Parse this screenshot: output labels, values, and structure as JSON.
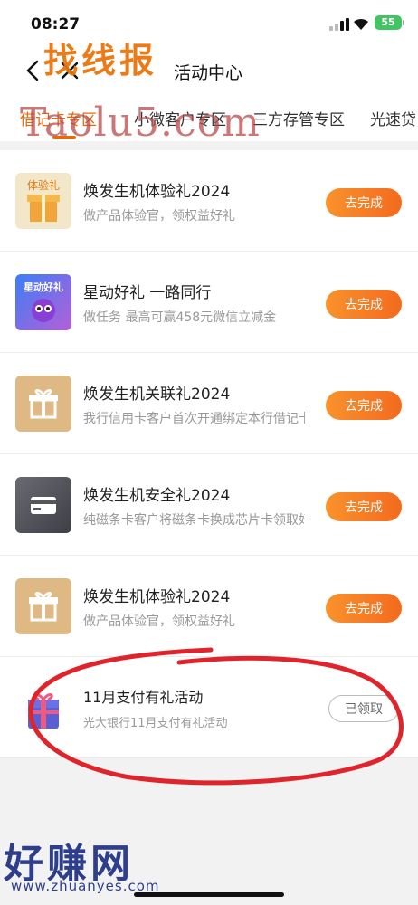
{
  "status": {
    "time": "08:27",
    "battery": "55"
  },
  "nav": {
    "title": "活动中心"
  },
  "watermarks": {
    "top": "找线报",
    "mid": "Taolu5.com",
    "bottom": "好赚网",
    "url": "www.zhuanyes.com"
  },
  "tabs": [
    {
      "label": "借记卡专区",
      "active": true
    },
    {
      "label": "小微客户专区"
    },
    {
      "label": "三方存管专区"
    },
    {
      "label": "光速贷"
    }
  ],
  "activities": [
    {
      "title": "焕发生机体验礼2024",
      "desc": "做产品体验官，领权益好礼",
      "action": "去完成",
      "thumb": "gift-box-icon",
      "thumb_text": "体验礼"
    },
    {
      "title": "星动好礼 一路同行",
      "desc": "做任务 最高可赢458元微信立减金",
      "action": "去完成",
      "thumb": "star-mascot-icon",
      "thumb_text": "星动好礼"
    },
    {
      "title": "焕发生机关联礼2024",
      "desc": "我行信用卡客户首次开通绑定本行借记卡",
      "action": "去完成",
      "thumb": "gift-icon"
    },
    {
      "title": "焕发生机安全礼2024",
      "desc": "纯磁条卡客户将磁条卡换成芯片卡领取好礼",
      "action": "去完成",
      "thumb": "card-icon"
    },
    {
      "title": "焕发生机体验礼2024",
      "desc": "做产品体验官，领权益好礼",
      "action": "去完成",
      "thumb": "gift-icon"
    },
    {
      "title": "11月支付有礼活动",
      "desc": "光大银行11月支付有礼活动",
      "action": "已领取",
      "thumb": "purple-gift-icon"
    }
  ],
  "colors": {
    "accent": "#e26b10",
    "button": "#f46a1e",
    "annotation": "#e0242c"
  }
}
